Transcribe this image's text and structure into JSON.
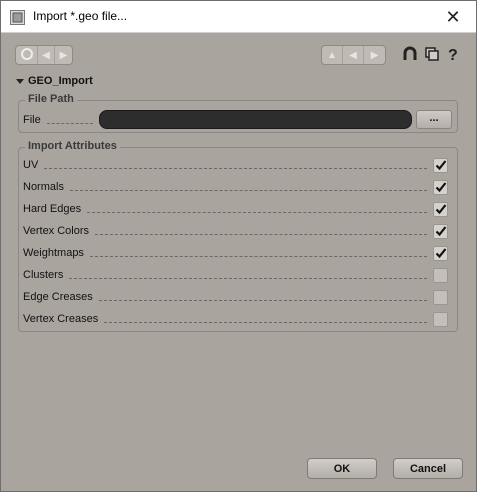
{
  "window": {
    "title": "Import *.geo file...",
    "close_glyph": "✕"
  },
  "toolbar": {
    "left_icons": [
      "key-icon",
      "arrow-left-icon",
      "arrow-right-icon"
    ],
    "arrow_icons": [
      "arrow-up-icon",
      "arrow-left-icon",
      "arrow-right-icon"
    ],
    "right_icons": [
      "magnet-icon",
      "copy-icon",
      "help-icon"
    ]
  },
  "section": {
    "title": "GEO_Import"
  },
  "file_path": {
    "group_title": "File Path",
    "file_label": "File",
    "file_value": "",
    "browse_label": "..."
  },
  "attributes": {
    "group_title": "Import Attributes",
    "items": [
      {
        "label": "UV",
        "checked": true
      },
      {
        "label": "Normals",
        "checked": true
      },
      {
        "label": "Hard Edges",
        "checked": true
      },
      {
        "label": "Vertex Colors",
        "checked": true
      },
      {
        "label": "Weightmaps",
        "checked": true
      },
      {
        "label": "Clusters",
        "checked": false
      },
      {
        "label": "Edge Creases",
        "checked": false
      },
      {
        "label": "Vertex Creases",
        "checked": false
      }
    ]
  },
  "buttons": {
    "ok": "OK",
    "cancel": "Cancel"
  }
}
